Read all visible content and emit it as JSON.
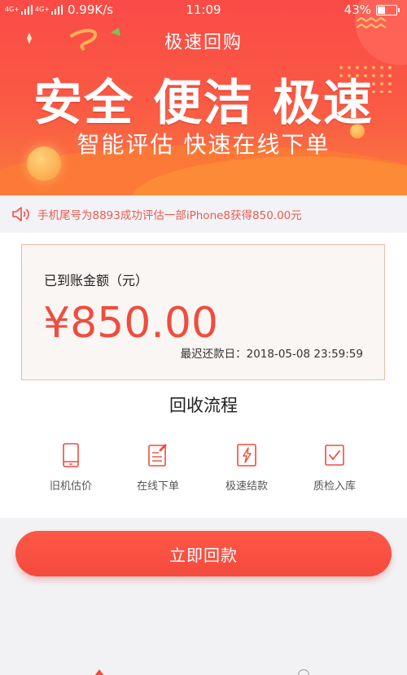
{
  "status_bar": {
    "signal_1": "4G+",
    "signal_2": "4G+",
    "net_speed": "0.99K/s",
    "time": "11:09",
    "battery_percent": "43%",
    "battery_level": 0.43
  },
  "hero": {
    "title": "极速回购",
    "headline": "安全 便洁 极速",
    "subline": "智能评估 快速在线下单"
  },
  "notice": {
    "icon": "speaker-icon",
    "text": "手机尾号为8893成功评估一部iPhone8获得850.00元"
  },
  "account": {
    "label": "已到账金额（元）",
    "amount": "¥850.00",
    "due": "最迟还款日：2018-05-08 23:59:59"
  },
  "flow": {
    "title": "回收流程",
    "steps": [
      {
        "label": "旧机估价",
        "icon": "phone-icon"
      },
      {
        "label": "在线下单",
        "icon": "edit-document-icon"
      },
      {
        "label": "极速结款",
        "icon": "lightning-icon"
      },
      {
        "label": "质检入库",
        "icon": "check-box-icon"
      }
    ]
  },
  "cta": {
    "label": "立即回款"
  },
  "colors": {
    "accent": "#ef4d3f",
    "hero_top": "#fa4b46",
    "card_border": "#f2b9a8"
  }
}
